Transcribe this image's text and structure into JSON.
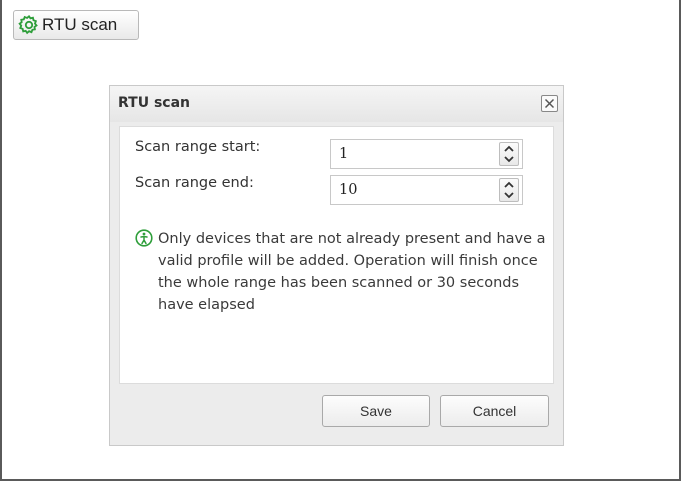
{
  "toolbar": {
    "rtu_scan_label": "RTU scan",
    "rtu_scan_icon": "gear-icon"
  },
  "dialog": {
    "title": "RTU scan",
    "close_icon": "close-icon",
    "fields": [
      {
        "label": "Scan range start:",
        "value": "1"
      },
      {
        "label": "Scan range end:",
        "value": "10"
      }
    ],
    "info_icon": "info-icon",
    "info_text": "Only devices that are not already present and have a valid profile will be added. Operation will finish once the whole range has been scanned or 30 seconds have elapsed",
    "save_label": "Save",
    "cancel_label": "Cancel"
  },
  "colors": {
    "accent": "#2e9e3a",
    "button_border": "#a9a9a9"
  }
}
